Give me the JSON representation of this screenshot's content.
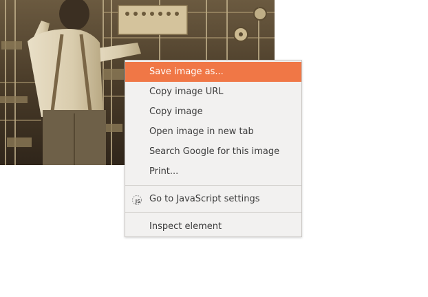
{
  "context_menu": {
    "items": [
      {
        "label": "Save image as...",
        "active": true
      },
      {
        "label": "Copy image URL"
      },
      {
        "label": "Copy image"
      },
      {
        "label": "Open image in new tab"
      },
      {
        "label": "Search Google for this image"
      },
      {
        "label": "Print..."
      }
    ],
    "js_settings": {
      "label": "Go to JavaScript settings",
      "icon": "javascript-settings-icon"
    },
    "inspect": {
      "label": "Inspect element"
    }
  },
  "colors": {
    "highlight": "#f07746",
    "menu_bg": "#f2f1f0",
    "menu_text": "#3c3c3c",
    "photo_tone": "#d8c9a8"
  }
}
